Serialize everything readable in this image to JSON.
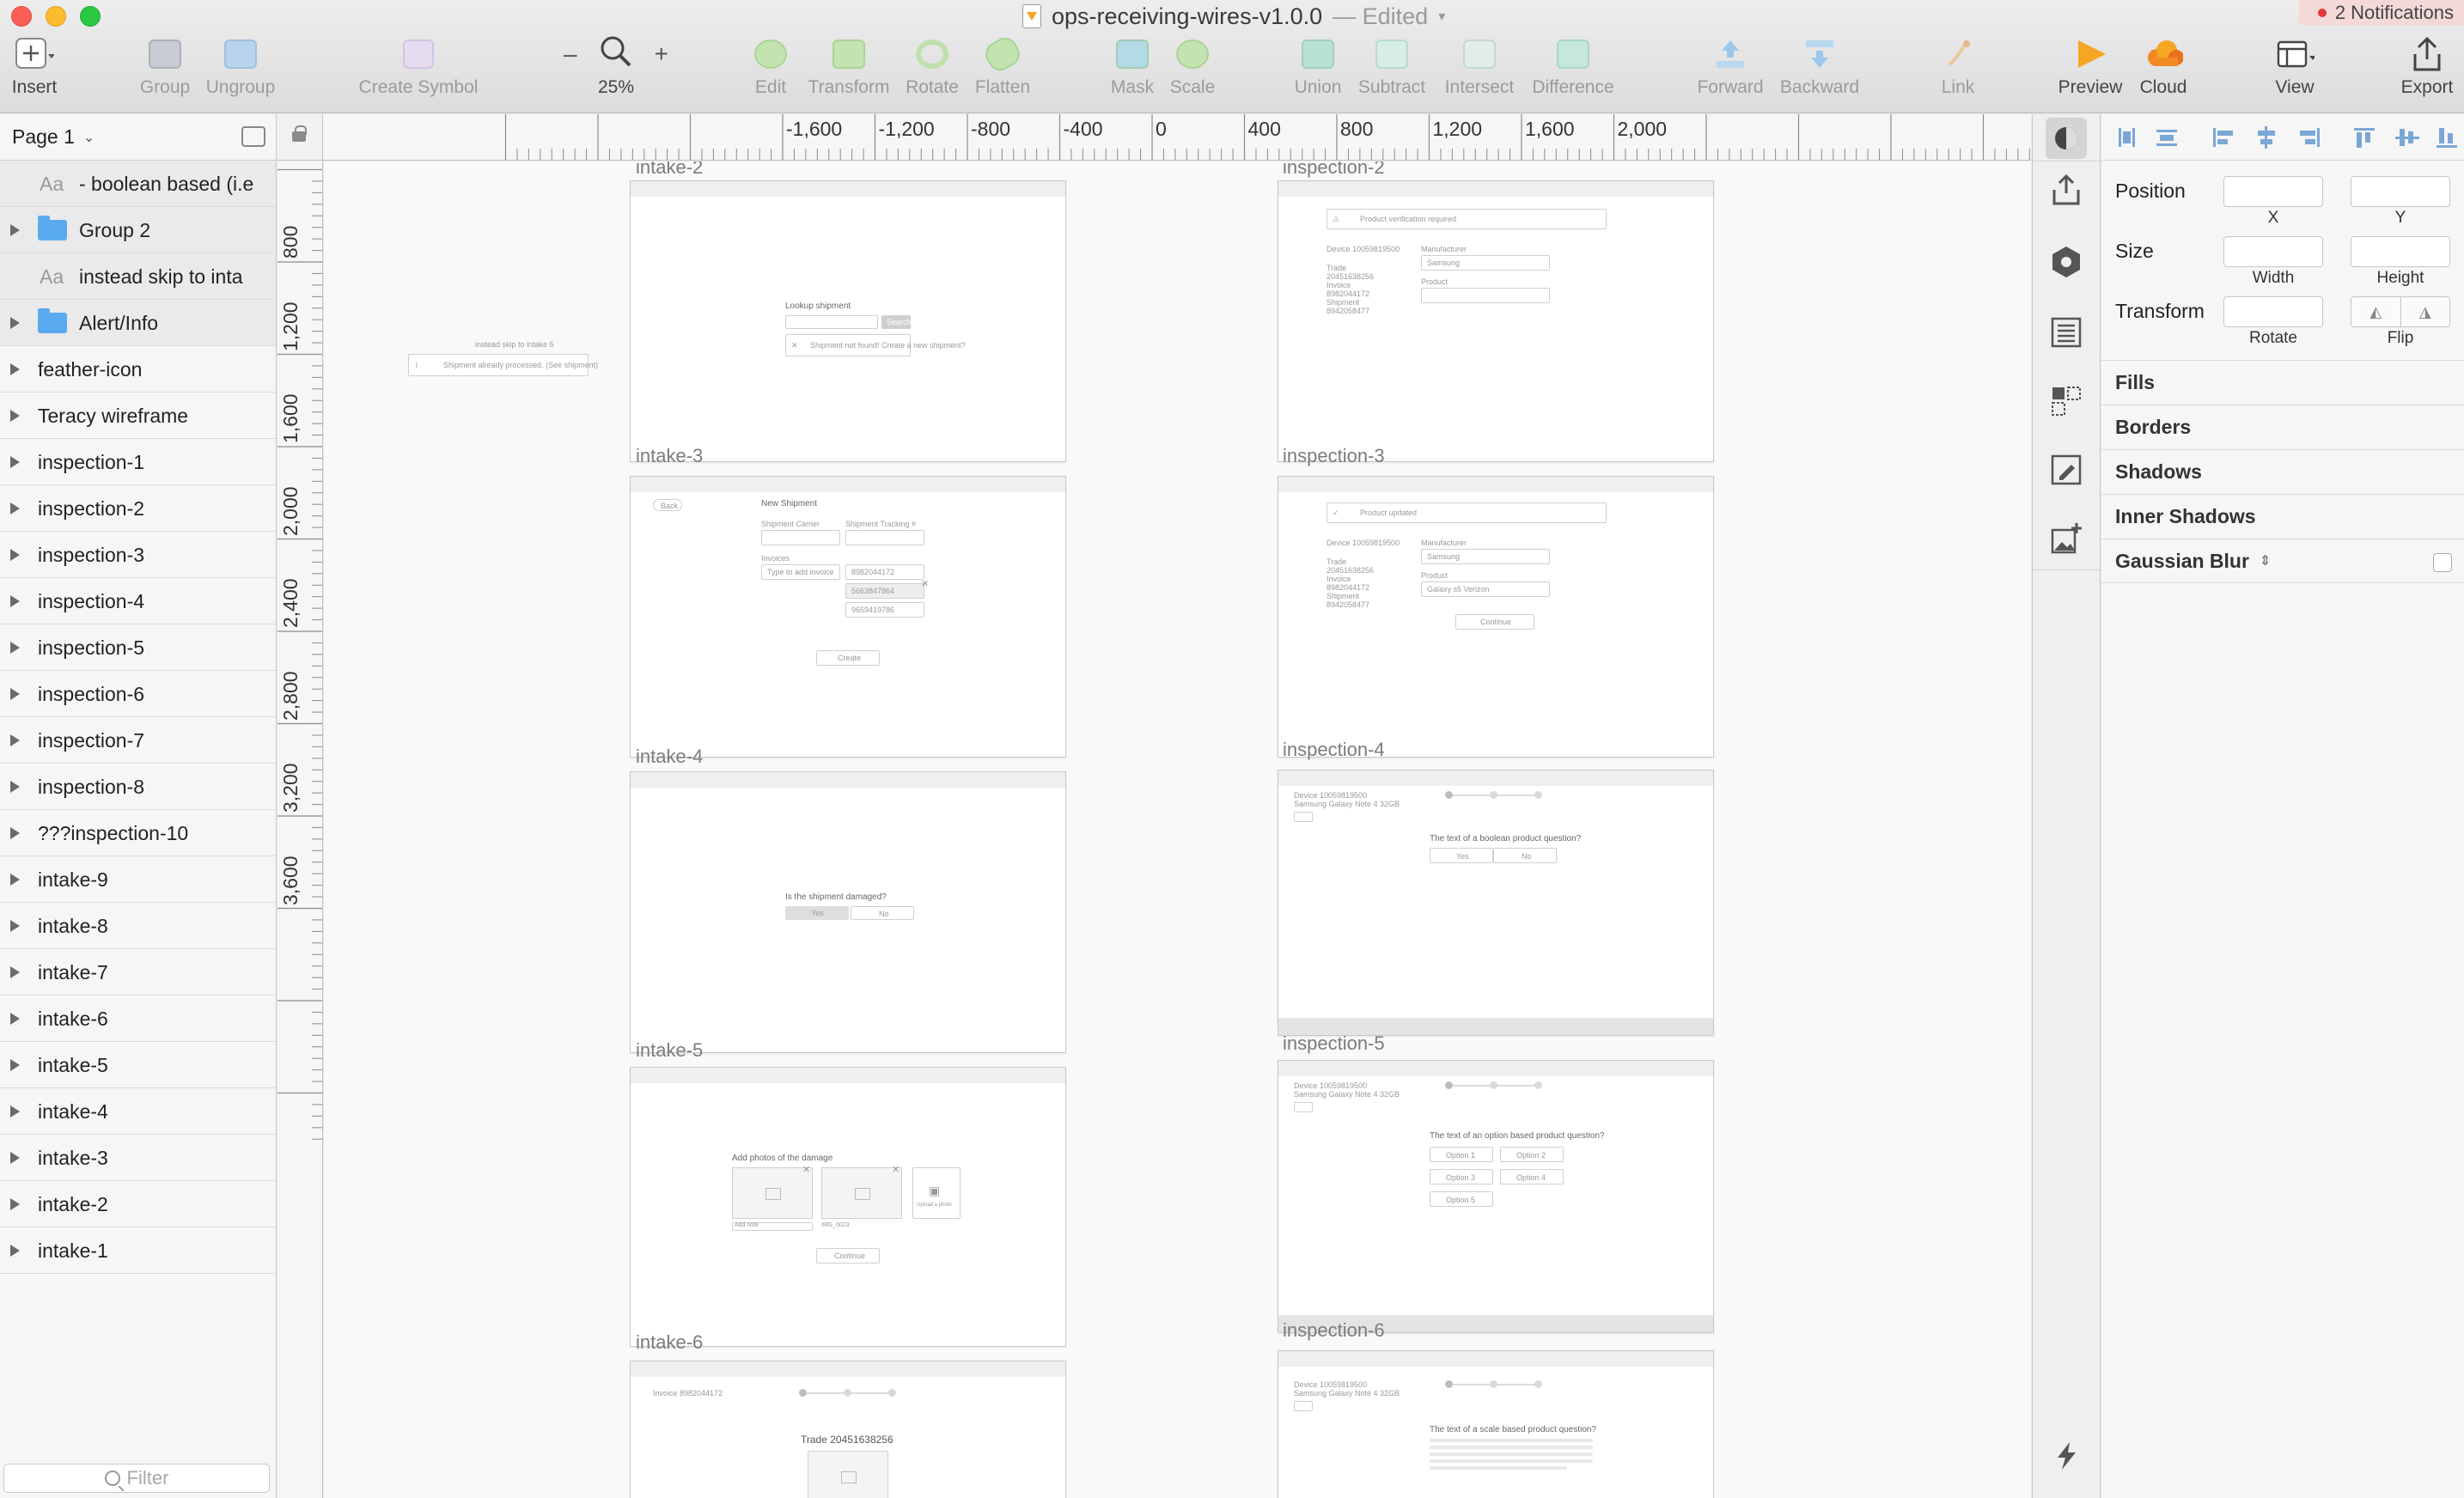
{
  "window": {
    "title": "ops-receiving-wires-v1.0.0",
    "edited": "— Edited",
    "notifications": "2 Notifications"
  },
  "toolbar": {
    "insert": "Insert",
    "group": "Group",
    "ungroup": "Ungroup",
    "create_symbol": "Create Symbol",
    "zoom_out": "–",
    "zoom_in": "+",
    "zoom": "25%",
    "edit": "Edit",
    "transform": "Transform",
    "rotate": "Rotate",
    "flatten": "Flatten",
    "mask": "Mask",
    "scale": "Scale",
    "union": "Union",
    "subtract": "Subtract",
    "intersect": "Intersect",
    "difference": "Difference",
    "forward": "Forward",
    "backward": "Backward",
    "link": "Link",
    "preview": "Preview",
    "cloud": "Cloud",
    "view": "View",
    "export": "Export"
  },
  "layers": {
    "page": "Page 1",
    "filter_placeholder": "Filter",
    "items": [
      {
        "label": "- boolean based (i.e",
        "kind": "text",
        "nested": true
      },
      {
        "label": "Group 2",
        "kind": "folder",
        "nested": true
      },
      {
        "label": "instead skip to inta",
        "kind": "text",
        "nested": true
      },
      {
        "label": "Alert/Info",
        "kind": "folder",
        "nested": true
      },
      {
        "label": "feather-icon",
        "kind": "artboard"
      },
      {
        "label": "Teracy wireframe",
        "kind": "artboard"
      },
      {
        "label": "inspection-1",
        "kind": "artboard"
      },
      {
        "label": "inspection-2",
        "kind": "artboard"
      },
      {
        "label": "inspection-3",
        "kind": "artboard"
      },
      {
        "label": "inspection-4",
        "kind": "artboard"
      },
      {
        "label": "inspection-5",
        "kind": "artboard"
      },
      {
        "label": "inspection-6",
        "kind": "artboard"
      },
      {
        "label": "inspection-7",
        "kind": "artboard"
      },
      {
        "label": "inspection-8",
        "kind": "artboard"
      },
      {
        "label": "???inspection-10",
        "kind": "artboard"
      },
      {
        "label": "intake-9",
        "kind": "artboard"
      },
      {
        "label": "intake-8",
        "kind": "artboard"
      },
      {
        "label": "intake-7",
        "kind": "artboard"
      },
      {
        "label": "intake-6",
        "kind": "artboard"
      },
      {
        "label": "intake-5",
        "kind": "artboard"
      },
      {
        "label": "intake-4",
        "kind": "artboard"
      },
      {
        "label": "intake-3",
        "kind": "artboard"
      },
      {
        "label": "intake-2",
        "kind": "artboard"
      },
      {
        "label": "intake-1",
        "kind": "artboard"
      }
    ]
  },
  "rulers": {
    "horizontal": [
      "-1,600",
      "-1,200",
      "-800",
      "-400",
      "0",
      "400",
      "800",
      "1,200",
      "1,600",
      "2,000"
    ],
    "vertical": [
      "800",
      "1,200",
      "1,600",
      "2,000",
      "2,400",
      "2,800",
      "3,200",
      "3,600"
    ]
  },
  "canvas": {
    "labels": {
      "intake_2": "intake-2",
      "inspection_2": "inspection-2",
      "intake_3": "intake-3",
      "inspection_3": "inspection-3",
      "intake_4": "intake-4",
      "inspection_4": "inspection-4",
      "intake_5": "intake-5",
      "inspection_5": "inspection-5",
      "intake_6": "intake-6",
      "inspection_6": "inspection-6"
    },
    "floating": {
      "heading": "instead skip to intake 6",
      "input": "Shipment already processed. (See shipment)"
    },
    "intake_3": {
      "title": "Lookup shipment",
      "search": "Search",
      "hint": "Shipment not found! Create a new shipment?"
    },
    "intake_4": {
      "back": "Back",
      "title": "New Shipment",
      "carrier": "Shipment Carrier",
      "tracking": "Shipment Tracking #",
      "invoices": "Invoices",
      "invoice_placeholder": "Type to add invoice",
      "invoice_1": "8982044172",
      "invoice_2": "5663847864",
      "invoice_3": "9659419786",
      "create": "Create"
    },
    "intake_5": {
      "question": "Is the shipment damaged?",
      "yes": "Yes",
      "no": "No"
    },
    "intake_6": {
      "title": "Add photos of the damage",
      "caption": "Add note",
      "caption_2": "IMG_0023",
      "upload": "Upload a photo",
      "continue": "Continue"
    },
    "intake_7": {
      "invoice": "Invoice 8982044172",
      "trade": "Trade 20451638256"
    },
    "inspection_3": {
      "field": "Product verification required",
      "device": "Device 10059819500",
      "manufacturer": "Manufacturer",
      "manufacturer_value": "Samsung",
      "trade": "Trade",
      "trade_value": "20451638256",
      "product": "Product",
      "invoice": "Invoice",
      "invoice_value": "8982044172",
      "shipment": "Shipment",
      "shipment_value": "8942058477"
    },
    "inspection_4": {
      "field": "Product updated",
      "device": "Device 10059819500",
      "manufacturer": "Manufacturer",
      "manufacturer_value": "Samsung",
      "trade": "Trade",
      "trade_value": "20451638256",
      "product": "Product",
      "product_value": "Galaxy s5 Verizon",
      "invoice": "Invoice",
      "invoice_value": "8982044172",
      "shipment": "Shipment",
      "shipment_value": "8942058477",
      "continue": "Continue"
    },
    "inspection_5": {
      "device": "Device 10059819500",
      "model": "Samsung Galaxy Note 4 32GB",
      "question": "The text of a boolean product question?",
      "yes": "Yes",
      "no": "No"
    },
    "inspection_6": {
      "device": "Device 10059819500",
      "model": "Samsung Galaxy Note 4 32GB",
      "question": "The text of an option based product question?",
      "option_1": "Option 1",
      "option_2": "Option 2",
      "option_3": "Option 3",
      "option_4": "Option 4",
      "option_5": "Option 5"
    },
    "inspection_7": {
      "device": "Device 10059819500",
      "model": "Samsung Galaxy Note 4 32GB",
      "question": "The text of a scale based product question?"
    }
  },
  "inspector": {
    "position": "Position",
    "x": "X",
    "y": "Y",
    "size": "Size",
    "width": "Width",
    "height": "Height",
    "transform": "Transform",
    "rotate": "Rotate",
    "flip": "Flip",
    "fills": "Fills",
    "borders": "Borders",
    "shadows": "Shadows",
    "inner_shadows": "Inner Shadows",
    "gaussian_blur": "Gaussian Blur"
  },
  "colors": {
    "preview_accent": "#f5a623",
    "cloud_accent": "#f08a24",
    "notification_dot": "#e0383e",
    "folder": "#5aaaf0",
    "align_icon": "#7aa7d6"
  }
}
